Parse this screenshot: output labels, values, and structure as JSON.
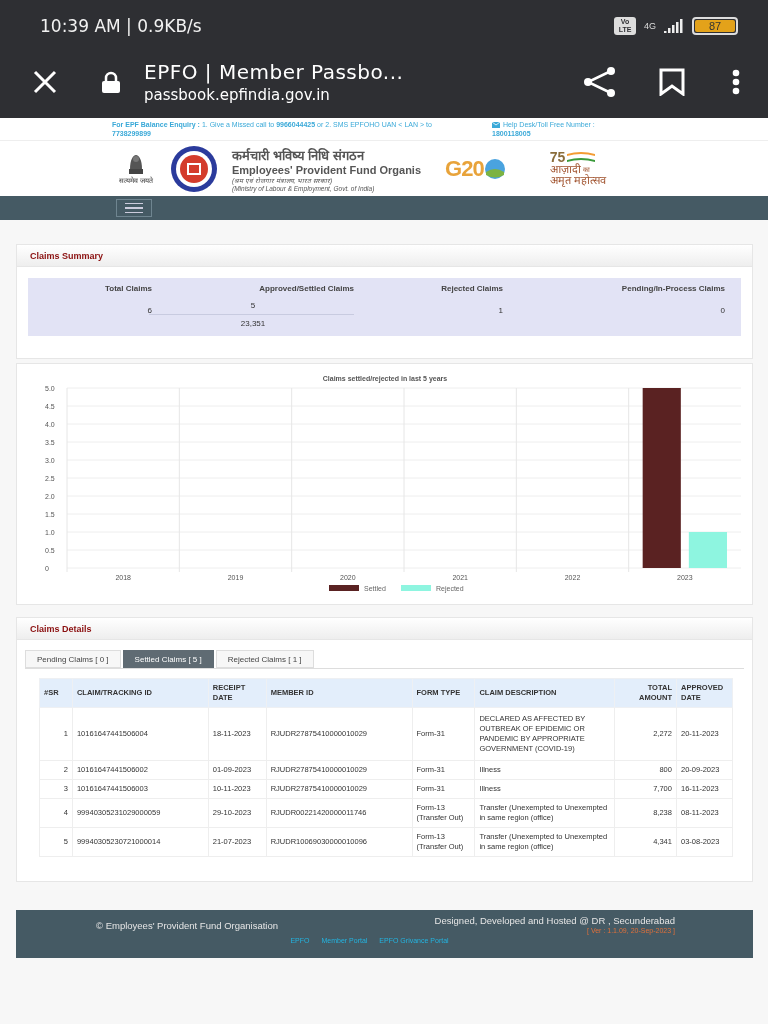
{
  "status_bar": {
    "time": "10:39 AM | 0.9KB/s",
    "volte": "Vo LTE",
    "network": "4G",
    "battery": "87"
  },
  "browser": {
    "title": "EPFO | Member Passbo...",
    "url": "passbook.epfindia.gov.in"
  },
  "info_strip": {
    "balance_label": "For EPF Balance Enquiry :",
    "balance_text": "1. Give a Missed call to **9966044425** or 2. SMS EPFOHO UAN < LAN > to **7738299899**",
    "helpdesk_label": "Help Desk/Toll Free Number :",
    "helpdesk_number": "1800118005"
  },
  "header": {
    "emblem_motto": "सत्यमेव जयते",
    "org_hindi": "कर्मचारी भविष्य निधि संगठन",
    "org_english": "Employees' Provident Fund Organis",
    "ministry_hindi": "(श्रम एवं रोजगार मंत्रालय, भारत सरकार)",
    "ministry_english": "(Ministry of Labour & Employment, Govt. of India)",
    "g20": "G20",
    "azadi_number": "75",
    "azadi_line1": "आज़ादी",
    "azadi_suffix": "का",
    "azadi_line2": "अमृत महोत्सव"
  },
  "claims_summary": {
    "title": "Claims Summary",
    "columns": [
      "Total Claims",
      "Approved/Settled Claims",
      "Rejected Claims",
      "Pending/In-Process Claims"
    ],
    "total": "6",
    "settled_count": "5",
    "settled_amount": "23,351",
    "rejected": "1",
    "pending": "0"
  },
  "chart_card": {
    "chart_data": {
      "type": "bar",
      "title": "Claims settled/rejected in last 5 years",
      "categories": [
        "2018",
        "2019",
        "2020",
        "2021",
        "2022",
        "2023"
      ],
      "series": [
        {
          "name": "Settled",
          "color": "#5a2222",
          "values": [
            0,
            0,
            0,
            0,
            0,
            5
          ]
        },
        {
          "name": "Rejected",
          "color": "#8ef5e0",
          "values": [
            0,
            0,
            0,
            0,
            0,
            1
          ]
        }
      ],
      "ylim": [
        0,
        5
      ],
      "grid": true,
      "legend": true,
      "yticks": [
        {
          "value": 0,
          "label": "0"
        },
        {
          "value": 0.5,
          "label": "0.5"
        },
        {
          "value": 1,
          "label": "1.0"
        },
        {
          "value": 1.5,
          "label": "1.5"
        },
        {
          "value": 2,
          "label": "2.0"
        },
        {
          "value": 2.5,
          "label": "2.5"
        },
        {
          "value": 3,
          "label": "3.0"
        },
        {
          "value": 3.5,
          "label": "3.5"
        },
        {
          "value": 4,
          "label": "4.0"
        },
        {
          "value": 4.5,
          "label": "4.5"
        },
        {
          "value": 5,
          "label": "5.0"
        }
      ]
    }
  },
  "claims_details": {
    "title": "Claims Details",
    "tabs": [
      {
        "label": "Pending Claims [ 0 ]",
        "selected": false
      },
      {
        "label": "Settled Claims [ 5 ]",
        "selected": true
      },
      {
        "label": "Rejected Claims [ 1 ]",
        "selected": false
      }
    ],
    "columns": [
      "#SR",
      "CLAIM/TRACKING ID",
      "RECEIPT DATE",
      "MEMBER ID",
      "FORM TYPE",
      "CLAIM DESCRIPTION",
      "TOTAL AMOUNT",
      "APPROVED DATE"
    ],
    "rows": [
      [
        "1",
        "10161647441506004",
        "18-11-2023",
        "RJUDR27875410000010029",
        "Form-31",
        "DECLARED AS AFFECTED BY OUTBREAK OF EPIDEMIC OR PANDEMIC BY APPROPRIATE GOVERNMENT (COVID-19)",
        "2,272",
        "20-11-2023"
      ],
      [
        "2",
        "10161647441506002",
        "01-09-2023",
        "RJUDR27875410000010029",
        "Form-31",
        "Illness",
        "800",
        "20-09-2023"
      ],
      [
        "3",
        "10161647441506003",
        "10-11-2023",
        "RJUDR27875410000010029",
        "Form-31",
        "Illness",
        "7,700",
        "16-11-2023"
      ],
      [
        "4",
        "99940305231029000059",
        "29-10-2023",
        "RJUDR00221420000011746",
        "Form-13 (Transfer Out)",
        "Transfer (Unexempted to Unexempted in same region (office)",
        "8,238",
        "08-11-2023"
      ],
      [
        "5",
        "99940305230721000014",
        "21-07-2023",
        "RJUDR10069030000010096",
        "Form-13 (Transfer Out)",
        "Transfer (Unexempted to Unexempted in same region (office)",
        "4,341",
        "03-08-2023"
      ]
    ]
  },
  "footer": {
    "copyright": "© Employees' Provident Fund Organisation",
    "hosted": "Designed, Developed and Hosted @ DR , Secunderabad",
    "version": "[ Ver : 1.1.09, 20-Sep-2023 ]",
    "links": [
      "EPFO",
      "Member Portal",
      "EPFO Grivance Portal"
    ]
  }
}
